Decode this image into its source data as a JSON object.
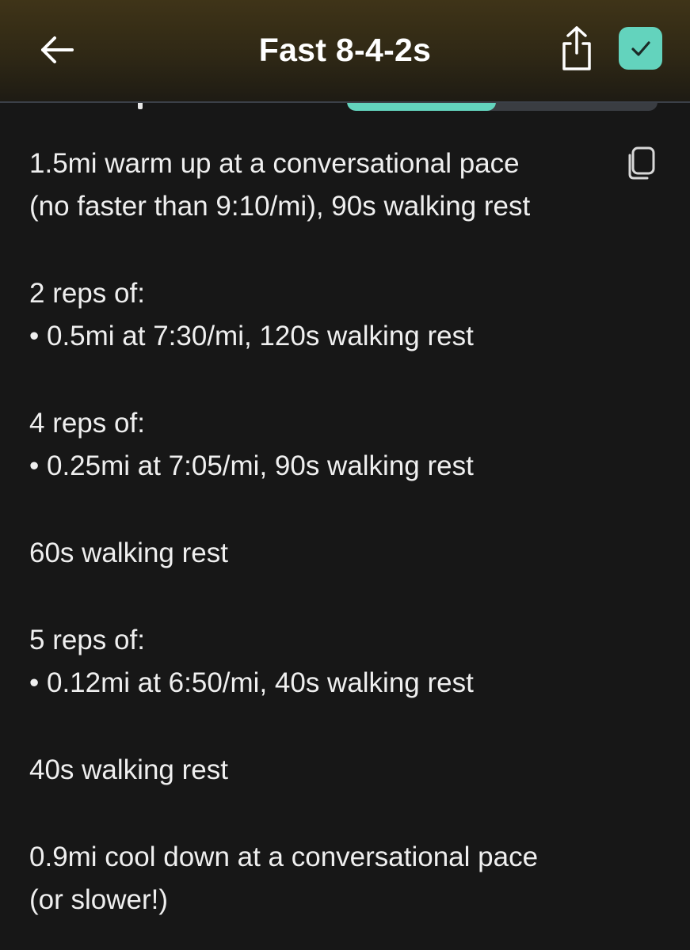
{
  "header": {
    "title": "Fast 8-4-2s",
    "back_icon": "arrow-left-icon",
    "share_icon": "share-icon",
    "done_icon": "checkmark-icon",
    "accent_color": "#63d3bd"
  },
  "workout": {
    "copy_icon": "copy-icon",
    "warmup": {
      "line1": "1.5mi warm up at a conversational pace",
      "line2": "(no faster than 9:10/mi), 90s walking rest"
    },
    "set1": {
      "heading": "2 reps of:",
      "item": "• 0.5mi at 7:30/mi, 120s walking rest"
    },
    "set2": {
      "heading": "4 reps of:",
      "item": "• 0.25mi at 7:05/mi, 90s walking rest"
    },
    "rest1": "60s walking rest",
    "set3": {
      "heading": "5 reps of:",
      "item": "• 0.12mi at 6:50/mi, 40s walking rest"
    },
    "rest2": "40s walking rest",
    "cooldown": {
      "line1": "0.9mi cool down at a conversational pace",
      "line2": "(or slower!)"
    }
  }
}
